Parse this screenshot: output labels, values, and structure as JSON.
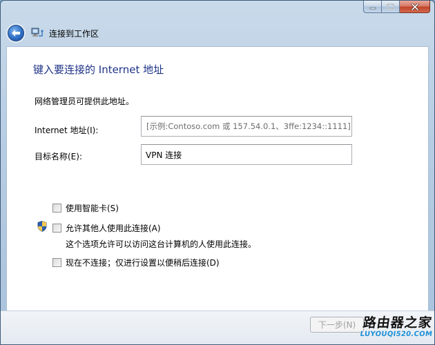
{
  "window": {
    "title": "连接到工作区",
    "colors": {
      "frame": "#b7cde3",
      "heading": "#1e3287",
      "close": "#c2442a"
    }
  },
  "caption_buttons": {
    "minimize": "minimize-icon",
    "maximize": "maximize-icon",
    "close": "close-icon"
  },
  "header": {
    "back_icon": "back-arrow-icon",
    "wizard_icon": "network-connection-icon"
  },
  "page": {
    "heading": "键入要连接的 Internet 地址",
    "description": "网络管理员可提供此地址。"
  },
  "fields": {
    "internet_address": {
      "label": "Internet 地址(I):",
      "placeholder": "[示例:Contoso.com 或 157.54.0.1、3ffe:1234::1111]"
    },
    "destination_name": {
      "label": "目标名称(E):",
      "value": "VPN 连接"
    }
  },
  "options": {
    "smart_card": {
      "label": "使用智能卡(S)",
      "checked": false
    },
    "allow_others": {
      "label": "允许其他人使用此连接(A)",
      "help": "这个选项允许可以访问这台计算机的人使用此连接。",
      "checked": false,
      "icon": "shield-icon"
    },
    "connect_later": {
      "label": "现在不连接；仅进行设置以便稍后连接(D)",
      "checked": false
    }
  },
  "footer": {
    "next_label": "下一步(N)"
  },
  "watermark": {
    "line1": "路由器之家",
    "line2": "LUYOUQI520.COM"
  }
}
